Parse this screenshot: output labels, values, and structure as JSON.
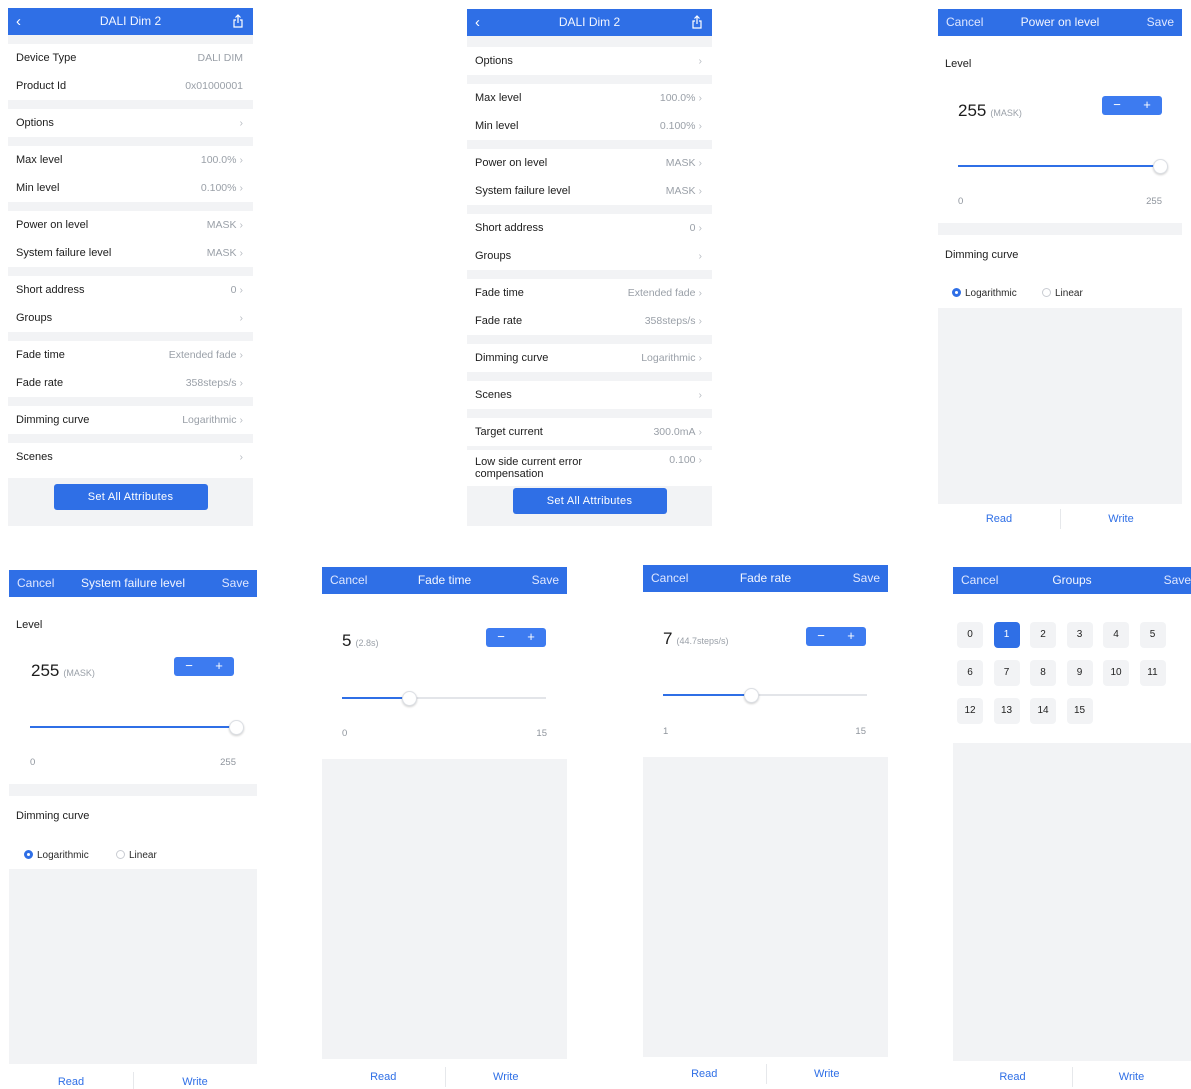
{
  "s1": {
    "title": "DALI Dim 2",
    "back_icon": "‹",
    "rows_a": [
      {
        "label": "Device Type",
        "value": "DALI DIM"
      },
      {
        "label": "Product Id",
        "value": "0x01000001"
      }
    ],
    "options": {
      "label": "Options"
    },
    "rows_b": [
      {
        "label": "Max level",
        "value": "100.0%"
      },
      {
        "label": "Min level",
        "value": "0.100%"
      }
    ],
    "rows_c": [
      {
        "label": "Power on level",
        "value": "MASK"
      },
      {
        "label": "System failure level",
        "value": "MASK"
      }
    ],
    "rows_d": [
      {
        "label": "Short address",
        "value": "0"
      },
      {
        "label": "Groups",
        "value": ""
      }
    ],
    "rows_e": [
      {
        "label": "Fade time",
        "value": "Extended fade"
      },
      {
        "label": "Fade rate",
        "value": "358steps/s"
      }
    ],
    "dimming": {
      "label": "Dimming curve",
      "value": "Logarithmic"
    },
    "scenes": {
      "label": "Scenes"
    },
    "set_all": "Set All Attributes"
  },
  "s2": {
    "title": "DALI Dim 2",
    "options": {
      "label": "Options"
    },
    "rows_b": [
      {
        "label": "Max level",
        "value": "100.0%"
      },
      {
        "label": "Min level",
        "value": "0.100%"
      }
    ],
    "rows_c": [
      {
        "label": "Power on level",
        "value": "MASK"
      },
      {
        "label": "System failure level",
        "value": "MASK"
      }
    ],
    "rows_d": [
      {
        "label": "Short address",
        "value": "0"
      },
      {
        "label": "Groups",
        "value": ""
      }
    ],
    "rows_e": [
      {
        "label": "Fade time",
        "value": "Extended fade"
      },
      {
        "label": "Fade rate",
        "value": "358steps/s"
      }
    ],
    "dimming": {
      "label": "Dimming curve",
      "value": "Logarithmic"
    },
    "scenes": {
      "label": "Scenes"
    },
    "target": {
      "label": "Target current",
      "value": "300.0mA"
    },
    "lowside": {
      "label": "Low side current error compensation",
      "value": "0.100"
    },
    "set_all": "Set All Attributes"
  },
  "common": {
    "cancel": "Cancel",
    "save": "Save",
    "read": "Read",
    "write": "Write",
    "chevron": "›",
    "minus": "−",
    "plus": "+",
    "level_label": "Level",
    "dimming_label": "Dimming curve",
    "logarithmic": "Logarithmic",
    "linear": "Linear"
  },
  "power_on": {
    "title": "Power on level",
    "value": "255",
    "note": "(MASK)",
    "min": "0",
    "max": "255",
    "fill_fraction": 1.0
  },
  "sys_fail": {
    "title": "System failure level",
    "value": "255",
    "note": "(MASK)",
    "min": "0",
    "max": "255",
    "fill_fraction": 1.0
  },
  "fade_time": {
    "title": "Fade time",
    "value": "5",
    "note": "(2.8s)",
    "min": "0",
    "max": "15",
    "fill_fraction": 0.33
  },
  "fade_rate": {
    "title": "Fade rate",
    "value": "7",
    "note": "(44.7steps/s)",
    "min": "1",
    "max": "15",
    "fill_fraction": 0.43
  },
  "groups": {
    "title": "Groups",
    "selected": "1",
    "items": [
      "0",
      "1",
      "2",
      "3",
      "4",
      "5",
      "6",
      "7",
      "8",
      "9",
      "10",
      "11",
      "12",
      "13",
      "14",
      "15"
    ]
  },
  "colors": {
    "accent": "#2f6fe6",
    "muted_bg": "#f2f3f5"
  },
  "icons": {
    "back": "chevron-left-icon",
    "share": "share-icon",
    "chevron": "chevron-right-icon"
  }
}
